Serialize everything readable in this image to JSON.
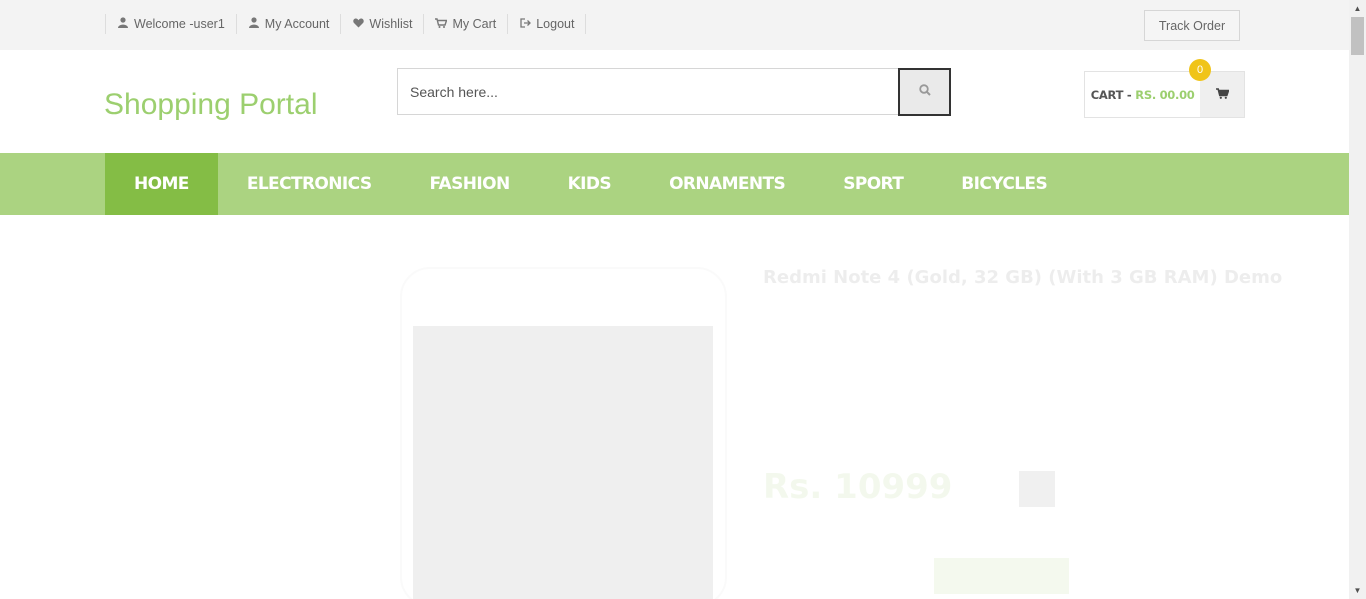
{
  "topbar": {
    "links": [
      {
        "icon": "user-icon",
        "glyph": "☺",
        "label": "Welcome -user1"
      },
      {
        "icon": "user-icon",
        "glyph": "☺",
        "label": "My Account"
      },
      {
        "icon": "heart-icon",
        "glyph": "♥",
        "label": "Wishlist"
      },
      {
        "icon": "cart-icon",
        "glyph": "⌂",
        "label": "My Cart"
      },
      {
        "icon": "logout-icon",
        "glyph": "↪",
        "label": "Logout"
      }
    ],
    "track_order": "Track Order"
  },
  "header": {
    "logo": "Shopping Portal",
    "search_placeholder": "Search here...",
    "cart_label": "CART -",
    "cart_amount": "RS. 00.00",
    "cart_count": "0"
  },
  "nav": {
    "items": [
      "HOME",
      "ELECTRONICS",
      "FASHION",
      "KIDS",
      "ORNAMENTS",
      "SPORT",
      "BICYCLES"
    ]
  },
  "colors": {
    "brand_green": "#9ccf6f",
    "nav_bg": "#abd381",
    "nav_active": "#84bd45",
    "badge_yellow": "#f0c419"
  },
  "product": {
    "title": "Redmi Note 4 (Gold, 32 GB) (With 3 GB RAM) Demo",
    "price": "Rs. 10999"
  }
}
